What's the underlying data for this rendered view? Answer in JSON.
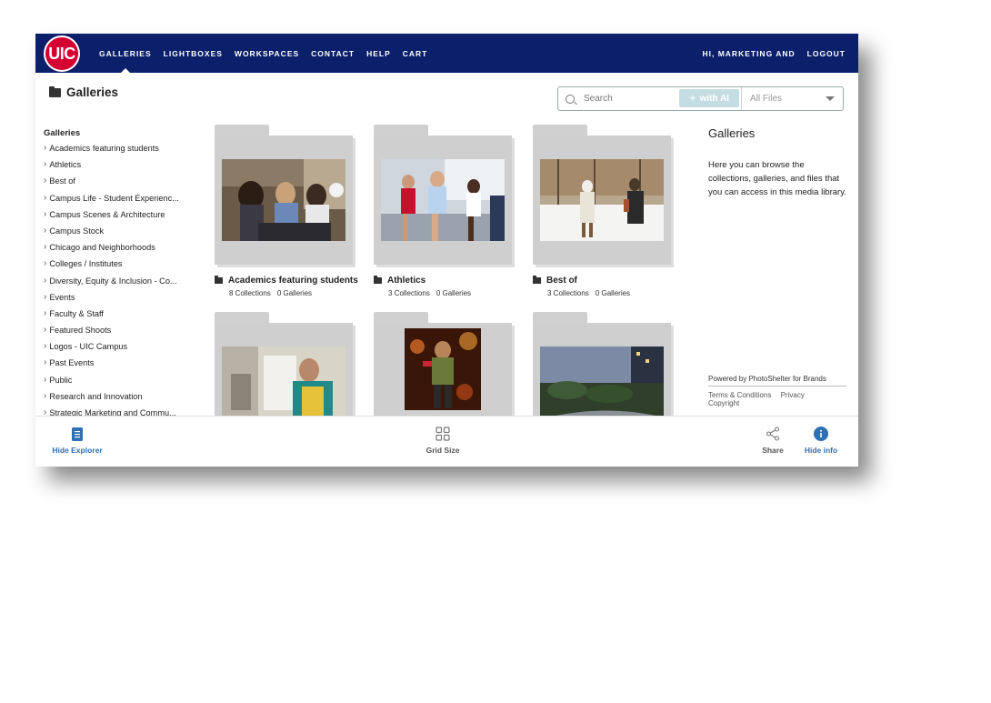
{
  "logo": {
    "text": "UIC",
    "color": "#d50032"
  },
  "nav": {
    "left": [
      "GALLERIES",
      "LIGHTBOXES",
      "WORKSPACES",
      "CONTACT",
      "HELP",
      "CART"
    ],
    "right": [
      "HI, MARKETING AND",
      "LOGOUT"
    ],
    "bg_color": "#0b1f6b"
  },
  "page_title": "Galleries",
  "search": {
    "placeholder": "Search",
    "ai_label": "with AI",
    "filter_value": "All Files"
  },
  "sidebar": {
    "heading": "Galleries",
    "items": [
      "Academics featuring students",
      "Athletics",
      "Best of",
      "Campus Life - Student Experienc...",
      "Campus Scenes & Architecture",
      "Campus Stock",
      "Chicago and Neighborhoods",
      "Colleges / Institutes",
      "Diversity, Equity & Inclusion - Co...",
      "Events",
      "Faculty & Staff",
      "Featured Shoots",
      "Logos - UIC Campus",
      "Past Events",
      "Public",
      "Research and Innovation",
      "Strategic Marketing and Commu..."
    ]
  },
  "cards": [
    {
      "title": "Academics featuring students",
      "collections": "8 Collections",
      "galleries": "0 Galleries",
      "thumb": "lab-students-photo"
    },
    {
      "title": "Athletics",
      "collections": "3 Collections",
      "galleries": "0 Galleries",
      "thumb": "runners-photo"
    },
    {
      "title": "Best of",
      "collections": "3 Collections",
      "galleries": "0 Galleries",
      "thumb": "snow-campus-photo"
    },
    {
      "title": "",
      "collections": "",
      "galleries": "",
      "thumb": "student-classroom-photo"
    },
    {
      "title": "",
      "collections": "",
      "galleries": "",
      "thumb": "performer-photo"
    },
    {
      "title": "",
      "collections": "",
      "galleries": "",
      "thumb": "campus-dusk-photo"
    }
  ],
  "info": {
    "heading": "Galleries",
    "text": "Here you can browse the collections, galleries, and files that you can access in this media library.",
    "powered": "Powered by PhotoShelter for Brands",
    "links": [
      "Terms & Conditions",
      "Privacy",
      "Copyright"
    ]
  },
  "bottom": {
    "hide_explorer": "Hide Explorer",
    "grid_size": "Grid Size",
    "share": "Share",
    "hide_info": "Hide info",
    "accent": "#2f6fb3"
  }
}
